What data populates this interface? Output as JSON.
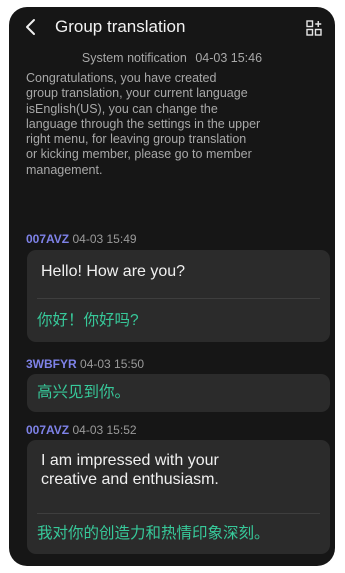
{
  "header": {
    "title": "Group translation",
    "back_icon": "chevron-left-icon",
    "menu_icon": "group-menu-icon"
  },
  "system_notice": {
    "label": "System notification",
    "timestamp": "04-03 15:46",
    "lines": [
      "Congratulations, you have created",
      "group translation, your current language",
      "isEnglish(US), you can change the",
      "language through the settings in the upper",
      "right menu, for leaving group translation",
      "or kicking member, please go to member",
      "management."
    ]
  },
  "messages": [
    {
      "sender": "007AVZ",
      "timestamp": "04-03 15:49",
      "lines": [
        "Hello! How are you?"
      ],
      "translation": "你好！你好吗?"
    },
    {
      "sender": "3WBFYR",
      "timestamp": "04-03 15:50",
      "translation": "高兴见到你。"
    },
    {
      "sender": "007AVZ",
      "timestamp": "04-03 15:52",
      "lines": [
        "I am impressed with your",
        "creative and enthusiasm."
      ],
      "translation": "我对你的创造力和热情印象深刻。"
    }
  ],
  "colors": {
    "background": "#161616",
    "bubble": "#2b2b2b",
    "sender": "#7e82e8",
    "translation": "#37c99a",
    "meta_text": "#a8a8a8"
  }
}
